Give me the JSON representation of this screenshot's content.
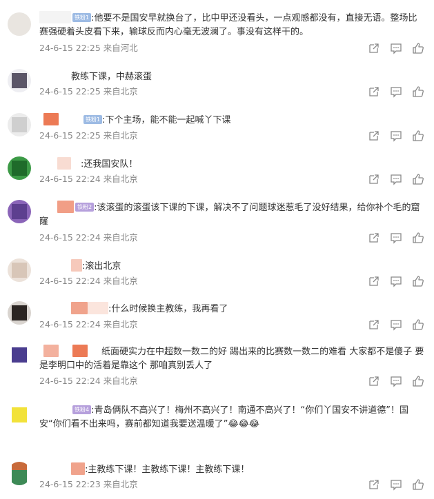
{
  "comments": [
    {
      "badge": "铁粉1",
      "text": ":他要不是国安早就换台了，比中甲还没看头，一点观感都没有，直接无语。整场比赛强硬着头皮看下来，输球反而内心毫无波澜了。事没有这样干的。",
      "time": "24-6-15 22:25",
      "location": "来自河北"
    },
    {
      "badge": "",
      "text": "教练下课，中赫滚蛋",
      "time": "24-6-15 22:25",
      "location": "来自北京"
    },
    {
      "badge": "铁粉1",
      "text": ":下个主场，能不能一起喊丫下课",
      "time": "24-6-15 22:25",
      "location": "来自北京"
    },
    {
      "badge": "",
      "text": ":还我国安队！",
      "time": "24-6-15 22:24",
      "location": "来自北京"
    },
    {
      "badge": "铁粉2",
      "text": ":该滚蛋的滚蛋该下课的下课，解决不了问题球迷惹毛了没好结果，给你补个毛的窟窿",
      "time": "24-6-15 22:24",
      "location": "来自北京"
    },
    {
      "badge": "",
      "text": ":滚出北京",
      "time": "24-6-15 22:24",
      "location": "来自北京"
    },
    {
      "badge": "",
      "text": ":什么时候换主教练，我再看了",
      "time": "24-6-15 22:24",
      "location": "来自北京"
    },
    {
      "badge": "",
      "text": "纸面硬实力在中超数一数二的好 踢出来的比赛数一数二的难看 大家都不是傻子 要是李明口中的活着是靠这个 那咱真别丢人了",
      "time": "24-6-15 22:24",
      "location": "来自北京"
    },
    {
      "badge": "铁粉4",
      "text": ":青岛俩队不高兴了！梅州不高兴了！南通不高兴了！“你们丫国安不讲道德”！国安“你们看不出来吗，赛前都知道我要送温暖了”",
      "emoji": "😂😂😂",
      "time": "",
      "location": ""
    },
    {
      "badge": "",
      "text": ":主教练下课！主教练下课！主教练下课！",
      "time": "24-6-15 22:23",
      "location": "来自北京"
    }
  ],
  "icons": {
    "share": "share-icon",
    "comment": "comment-icon",
    "like": "thumbs-up-icon"
  },
  "colors": {
    "text": "#333333",
    "meta": "#888888",
    "badge_blue": "#9dbbe4",
    "badge_purple": "#b6a0dc"
  }
}
